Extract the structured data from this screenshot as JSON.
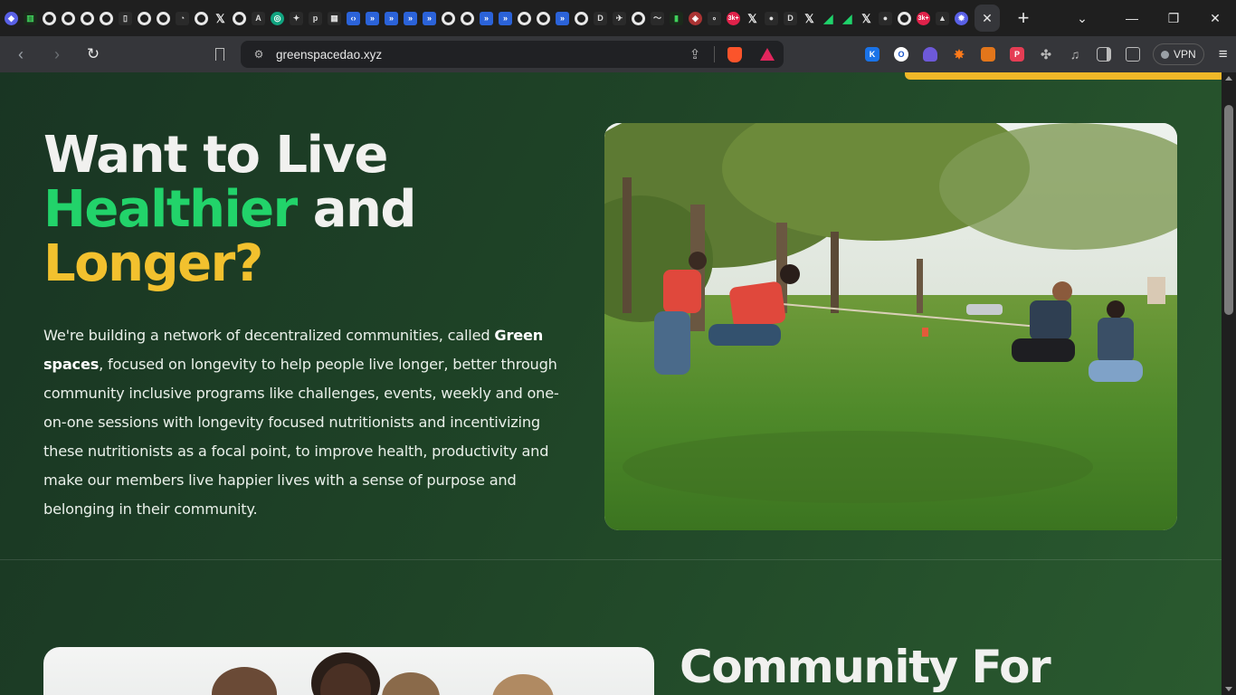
{
  "browser": {
    "tabs": [
      {
        "icon": "tab-app-icon"
      },
      {
        "icon": "tab-chart-icon"
      },
      {
        "icon": "github-icon"
      },
      {
        "icon": "github-icon"
      },
      {
        "icon": "github-icon"
      },
      {
        "icon": "github-icon"
      },
      {
        "icon": "tab-trash-icon"
      },
      {
        "icon": "github-icon"
      },
      {
        "icon": "github-icon"
      },
      {
        "icon": "tab-loading-icon"
      },
      {
        "icon": "github-icon"
      },
      {
        "icon": "x-icon"
      },
      {
        "icon": "github-icon"
      },
      {
        "icon": "anthropic-icon"
      },
      {
        "icon": "openai-icon"
      },
      {
        "icon": "gemini-icon"
      },
      {
        "icon": "tab-p-icon"
      },
      {
        "icon": "tab-qr-icon"
      },
      {
        "icon": "code-icon"
      },
      {
        "icon": "tab-blue-icon"
      },
      {
        "icon": "tab-blue-icon"
      },
      {
        "icon": "tab-blue-icon"
      },
      {
        "icon": "tab-blue-icon"
      },
      {
        "icon": "github-icon"
      },
      {
        "icon": "github-icon"
      },
      {
        "icon": "tab-blue-icon"
      },
      {
        "icon": "tab-blue-icon"
      },
      {
        "icon": "github-icon"
      },
      {
        "icon": "github-icon"
      },
      {
        "icon": "tab-blue-icon"
      },
      {
        "icon": "github-icon"
      },
      {
        "icon": "tab-d-icon"
      },
      {
        "icon": "tab-bird-icon"
      },
      {
        "icon": "github-icon"
      },
      {
        "icon": "tab-wing-icon"
      },
      {
        "icon": "tab-battery-icon"
      },
      {
        "icon": "tab-shield-icon"
      },
      {
        "icon": "tab-dots-icon"
      },
      {
        "icon": "tab-badge-icon"
      },
      {
        "icon": "x-icon"
      },
      {
        "icon": "tab-dark-icon"
      },
      {
        "icon": "tab-d-icon"
      },
      {
        "icon": "x-icon"
      },
      {
        "icon": "tab-green-icon"
      },
      {
        "icon": "tab-green-icon"
      },
      {
        "icon": "x-icon"
      },
      {
        "icon": "tab-dark-icon"
      },
      {
        "icon": "github-icon"
      },
      {
        "icon": "tab-badge-icon"
      },
      {
        "icon": "tab-triangle-icon"
      },
      {
        "icon": "tab-gear-icon"
      }
    ],
    "badge_text": "3k+",
    "active_tab_close": "✕",
    "new_tab": "+",
    "url": "greenspacedao.xyz",
    "vpn_label": "VPN"
  },
  "hero": {
    "line1": "Want to Live",
    "line2_highlight": "Healthier",
    "line2_rest": " and",
    "line3": "Longer?",
    "para_start": "We're building a network of decentralized communities, called ",
    "para_bold": "Green spaces",
    "para_end": ", focused on longevity to help people live longer, better through community inclusive programs like challenges, events, weekly and one-on-one sessions with longevity focused nutritionists and incentivizing these nutritionists as a focal point, to improve health, productivity and make our members live happier lives with a sense of purpose and belonging in their community."
  },
  "section2": {
    "heading": "Community For"
  },
  "colors": {
    "accent_green": "#22d36a",
    "accent_yellow": "#f2c12e",
    "page_bg": "#1f4427"
  }
}
